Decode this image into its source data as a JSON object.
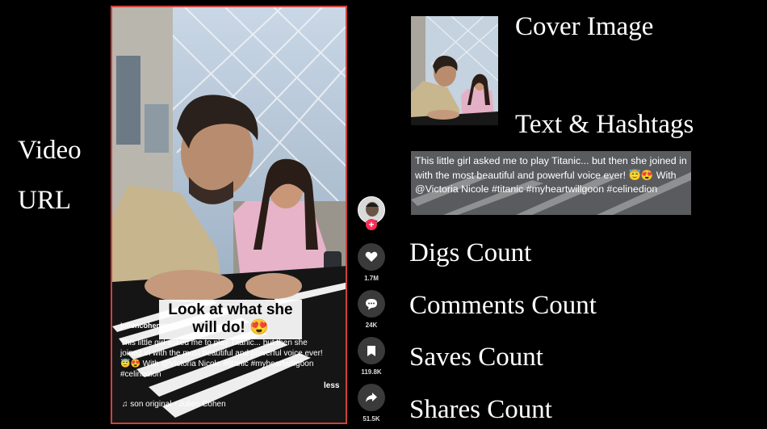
{
  "left_labels": {
    "line1": "Video",
    "line2": "URL"
  },
  "video": {
    "caption_overlay": "Look at what she will do! 😍",
    "username": "juliencohenpiano",
    "description": "This little girl asked me to play Titanic... but then she joined in with the most beautiful and powerful voice ever! 😇😍 With @Victoria Nicole   #titanic #myheartwillgoon  #celinedion",
    "less_label": "less",
    "sound": "♫ son original - Julien Cohen",
    "frame_color": "#d0413a"
  },
  "actions": {
    "follow_symbol": "+",
    "likes_count": "1.7M",
    "comments_count": "24K",
    "saves_count": "119.8K",
    "shares_count": "51.5K",
    "icons": [
      "heart-icon",
      "comment-bubble-icon",
      "bookmark-icon",
      "share-arrow-icon"
    ]
  },
  "right_labels": {
    "cover": "Cover Image",
    "text_hashtags": "Text & Hashtags",
    "digs": "Digs Count",
    "comments": "Comments Count",
    "saves": "Saves Count",
    "shares": "Shares Count"
  },
  "description_crop": "This little girl asked me to play Titanic... but then she joined in with the most beautiful and powerful voice ever! 😇😍 With @Victoria Nicole   #titanic #myheartwillgoon  #celinedion"
}
